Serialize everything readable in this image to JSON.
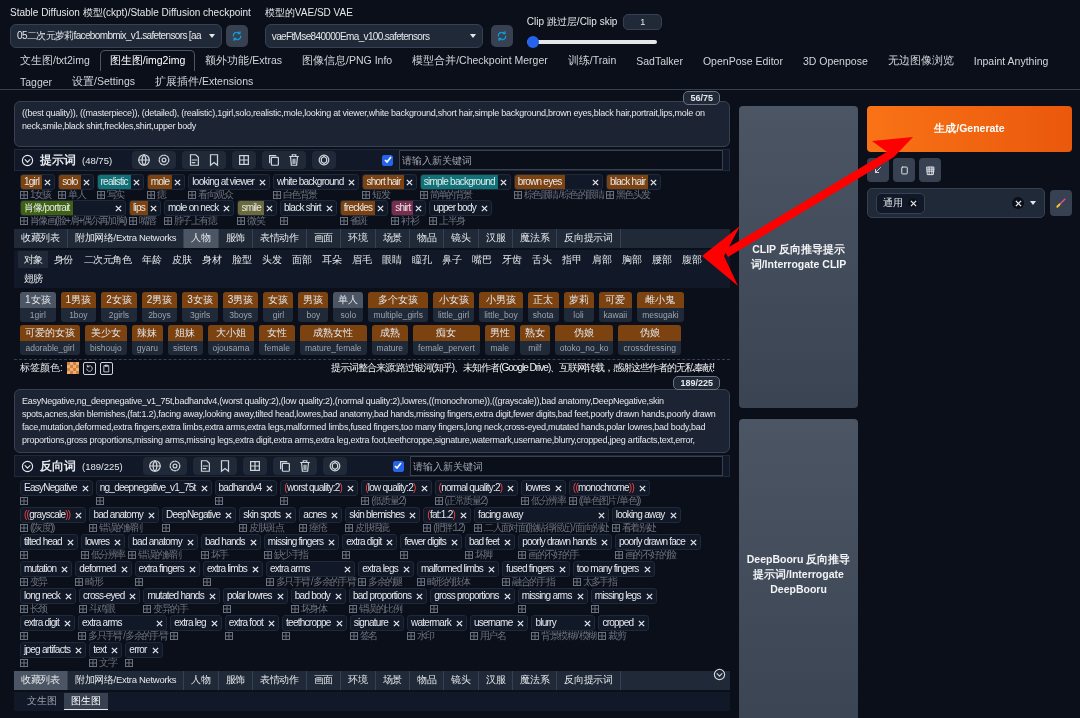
{
  "top": {
    "checkpoint": {
      "label": "Stable Diffusion 模型(ckpt)/Stable Diffusion checkpoint",
      "value": "05二次元萝莉facebombmix_v1.safetensors [aa"
    },
    "vae": {
      "label": "模型的VAE/SD VAE",
      "value": "vaeFtMse840000Ema_v100.safetensors"
    },
    "clip_skip": {
      "label": "Clip 跳过层/Clip skip",
      "value": "1",
      "level": 0
    }
  },
  "tabs": [
    {
      "label": "文生图/txt2img",
      "selected": false
    },
    {
      "label": "图生图/img2img",
      "selected": true
    },
    {
      "label": "额外功能/Extras",
      "selected": false
    },
    {
      "label": "图像信息/PNG Info",
      "selected": false
    },
    {
      "label": "模型合并/Checkpoint Merger",
      "selected": false
    },
    {
      "label": "训练/Train",
      "selected": false
    },
    {
      "label": "SadTalker",
      "selected": false
    },
    {
      "label": "OpenPose Editor",
      "selected": false
    },
    {
      "label": "3D Openpose",
      "selected": false
    },
    {
      "label": "无边图像浏览",
      "selected": false
    },
    {
      "label": "Inpaint Anything",
      "selected": false
    },
    {
      "label": "Tagger",
      "selected": false
    },
    {
      "label": "设置/Settings",
      "selected": false
    },
    {
      "label": "扩展插件/Extensions",
      "selected": false
    }
  ],
  "prompt": {
    "counter": "56/75",
    "text": "((best quality)), ((masterpiece)), (detailed), (realistic),1girl,solo,realistic,mole,looking at viewer,white background,short hair,simple background,brown eyes,black hair,portrait,lips,mole on neck,smile,black shirt,freckles,shirt,upper body",
    "title": "提示词",
    "count": "(48/75)",
    "checked": true,
    "placeholder": "请输入新关键词",
    "tags": [
      {
        "text": "1girl",
        "color": "#7c4210",
        "translation": "1女孩"
      },
      {
        "text": "solo",
        "color": "#7c4210",
        "translation": "单人"
      },
      {
        "text": "realistic",
        "color": "#0f7276",
        "translation": "写实"
      },
      {
        "text": "mole",
        "color": "#7c4210",
        "translation": "痣"
      },
      {
        "text": "looking at viewer",
        "translation": "看向观众"
      },
      {
        "text": "white background",
        "translation": "白色背景"
      },
      {
        "text": "short hair",
        "color": "#7c4210",
        "translation": "短发"
      },
      {
        "text": "simple background",
        "color": "#0f7276",
        "translation": "简单的背景"
      },
      {
        "text": "brown eyes",
        "color": "#7c4210",
        "translation": "棕色眼睛 / 棕色的眼睛"
      },
      {
        "text": "black hair",
        "color": "#7c4210",
        "translation": "黑色头发"
      },
      {
        "text": "肖像/portrait",
        "color": "#3f6212",
        "translation": "肖像画(脸+肩+偶尔再加胸)"
      },
      {
        "text": "lips",
        "color": "#7c4210",
        "translation": "嘴唇"
      },
      {
        "text": "mole on neck",
        "translation": "脖子上有痣"
      },
      {
        "text": "smile",
        "color": "#6b6a3c",
        "translation": "微笑"
      },
      {
        "text": "black shirt"
      },
      {
        "text": "freckles",
        "color": "#7c4210",
        "translation": "雀斑"
      },
      {
        "text": "shirt",
        "color": "#7a2d4c",
        "translation": "衬衫"
      },
      {
        "text": "upper body",
        "translation": "上半身"
      }
    ]
  },
  "categories": [
    {
      "label": "收藏列表",
      "selected": false
    },
    {
      "label": "附加网络/Extra Networks",
      "selected": false
    },
    {
      "label": "人物",
      "selected": true
    },
    {
      "label": "服饰",
      "selected": false
    },
    {
      "label": "表情动作",
      "selected": false
    },
    {
      "label": "画面",
      "selected": false
    },
    {
      "label": "环境",
      "selected": false
    },
    {
      "label": "场景",
      "selected": false
    },
    {
      "label": "物品",
      "selected": false
    },
    {
      "label": "镜头",
      "selected": false
    },
    {
      "label": "汉服",
      "selected": false
    },
    {
      "label": "魔法系",
      "selected": false
    },
    {
      "label": "反向提示词",
      "selected": false
    }
  ],
  "subcategories": [
    {
      "label": "对象",
      "selected": true
    },
    {
      "label": "身份",
      "selected": false
    },
    {
      "label": "二次元角色",
      "selected": false
    },
    {
      "label": "年龄",
      "selected": false
    },
    {
      "label": "皮肤",
      "selected": false
    },
    {
      "label": "身材",
      "selected": false
    },
    {
      "label": "脸型",
      "selected": false
    },
    {
      "label": "头发",
      "selected": false
    },
    {
      "label": "面部",
      "selected": false
    },
    {
      "label": "耳朵",
      "selected": false
    },
    {
      "label": "眉毛",
      "selected": false
    },
    {
      "label": "眼睛",
      "selected": false
    },
    {
      "label": "瞳孔",
      "selected": false
    },
    {
      "label": "鼻子",
      "selected": false
    },
    {
      "label": "嘴巴",
      "selected": false
    },
    {
      "label": "牙齿",
      "selected": false
    },
    {
      "label": "舌头",
      "selected": false
    },
    {
      "label": "指甲",
      "selected": false
    },
    {
      "label": "肩部",
      "selected": false
    },
    {
      "label": "胸部",
      "selected": false
    },
    {
      "label": "腰部",
      "selected": false
    },
    {
      "label": "腹部",
      "selected": false
    },
    {
      "label": "翅膀",
      "selected": false
    }
  ],
  "keywords": [
    {
      "zh": "1女孩",
      "en": "1girl",
      "added": true
    },
    {
      "zh": "1男孩",
      "en": "1boy",
      "added": false
    },
    {
      "zh": "2女孩",
      "en": "2girls",
      "added": false
    },
    {
      "zh": "2男孩",
      "en": "2boys",
      "added": false
    },
    {
      "zh": "3女孩",
      "en": "3girls",
      "added": false
    },
    {
      "zh": "3男孩",
      "en": "3boys",
      "added": false
    },
    {
      "zh": "女孩",
      "en": "girl",
      "added": false
    },
    {
      "zh": "男孩",
      "en": "boy",
      "added": false
    },
    {
      "zh": "单人",
      "en": "solo",
      "added": true
    },
    {
      "zh": "多个女孩",
      "en": "multiple_girls",
      "added": false
    },
    {
      "zh": "小女孩",
      "en": "little_girl",
      "added": false
    },
    {
      "zh": "小男孩",
      "en": "little_boy",
      "added": false
    },
    {
      "zh": "正太",
      "en": "shota",
      "added": false
    },
    {
      "zh": "萝莉",
      "en": "loli",
      "added": false
    },
    {
      "zh": "可爱",
      "en": "kawaii",
      "added": false
    },
    {
      "zh": "雌小鬼",
      "en": "mesugaki",
      "added": false
    },
    {
      "zh": "可爱的女孩",
      "en": "adorable_girl",
      "added": false
    },
    {
      "zh": "美少女",
      "en": "bishoujo",
      "added": false
    },
    {
      "zh": "辣妹",
      "en": "gyaru",
      "added": false
    },
    {
      "zh": "姐妹",
      "en": "sisters",
      "added": false
    },
    {
      "zh": "大小姐",
      "en": "ojousama",
      "added": false
    },
    {
      "zh": "女性",
      "en": "female",
      "added": false
    },
    {
      "zh": "成熟女性",
      "en": "mature_female",
      "added": false
    },
    {
      "zh": "成熟",
      "en": "mature",
      "added": false
    },
    {
      "zh": "痴女",
      "en": "female_pervert",
      "added": false
    },
    {
      "zh": "男性",
      "en": "male",
      "added": false
    },
    {
      "zh": "熟女",
      "en": "milf",
      "added": false
    },
    {
      "zh": "伪娘",
      "en": "otoko_no_ko",
      "added": false
    },
    {
      "zh": "伪娘",
      "en": "crossdressing",
      "added": false
    }
  ],
  "tag_color_label": "标签颜色:",
  "credits": "提示词整合来源:路过银河(知乎)、未知作者(Google Drive)、互联网转载，感谢这些作者的无私奉献!",
  "negative": {
    "counter": "189/225",
    "text": "EasyNegative,ng_deepnegative_v1_75t,badhandv4,(worst quality:2),(low quality:2),(normal quality:2),lowres,((monochrome)),((grayscale)),bad anatomy,DeepNegative,skin spots,acnes,skin blemishes,(fat:1.2),facing away,looking away,tilted head,lowres,bad anatomy,bad hands,missing fingers,extra digit,fewer digits,bad feet,poorly drawn hands,poorly drawn face,mutation,deformed,extra fingers,extra limbs,extra arms,extra legs,malformed limbs,fused fingers,too many fingers,long neck,cross-eyed,mutated hands,polar lowres,bad body,bad proportions,gross proportions,missing arms,missing legs,extra digit,extra arms,extra leg,extra foot,teethcroppe,signature,watermark,username,blurry,cropped,jpeg artifacts,text,error,",
    "title": "反向词",
    "count": "(189/225)",
    "checked": true,
    "placeholder": "请输入新关键词",
    "tags": [
      {
        "text": "EasyNegative"
      },
      {
        "text": "ng_deepnegative_v1_75t"
      },
      {
        "text": "badhandv4"
      },
      {
        "text": "worst quality:2",
        "open": "(",
        "close": ")"
      },
      {
        "text": "low quality:2",
        "open": "(",
        "close": ")",
        "translation": "(低质量:2)"
      },
      {
        "text": "normal quality:2",
        "open": "(",
        "close": ")",
        "translation": "(正常质量:2)"
      },
      {
        "text": "lowres",
        "translation": "低分辨率"
      },
      {
        "text": "monochrome",
        "open": "((",
        "close": "))",
        "translation": "((单色图片 / 单色))"
      },
      {
        "text": "grayscale",
        "open": "((",
        "close": "))",
        "translation": "((灰度))"
      },
      {
        "text": "bad anatomy",
        "translation": "错误的解剖"
      },
      {
        "text": "DeepNegative"
      },
      {
        "text": "skin spots",
        "translation": "皮肤斑点"
      },
      {
        "text": "acnes",
        "translation": "痤疮"
      },
      {
        "text": "skin blemishes",
        "translation": "皮肤瑕疵"
      },
      {
        "text": "fat:1.2",
        "open": "(",
        "close": ")",
        "translation": "(肥胖:1.2)"
      },
      {
        "text": "facing away",
        "translation": "二人面对面(脸贴得很近) / 面向别处"
      },
      {
        "text": "looking away",
        "translation": "看着别处"
      },
      {
        "text": "tilted head"
      },
      {
        "text": "lowres",
        "translation": "低分辨率"
      },
      {
        "text": "bad anatomy",
        "translation": "错误的解剖"
      },
      {
        "text": "bad hands",
        "translation": "坏手"
      },
      {
        "text": "missing fingers",
        "translation": "缺少手指"
      },
      {
        "text": "extra digit"
      },
      {
        "text": "fewer digits"
      },
      {
        "text": "bad feet",
        "translation": "坏脚"
      },
      {
        "text": "poorly drawn hands",
        "translation": "画的不好的手"
      },
      {
        "text": "poorly drawn face",
        "translation": "画的不好的脸"
      },
      {
        "text": "mutation",
        "translation": "变异"
      },
      {
        "text": "deformed",
        "translation": "畸形"
      },
      {
        "text": "extra fingers"
      },
      {
        "text": "extra limbs"
      },
      {
        "text": "extra arms",
        "translation": "多只手臂 / 多余的手臂"
      },
      {
        "text": "extra legs",
        "translation": "多余的腿"
      },
      {
        "text": "malformed limbs",
        "translation": "畸形的肢体"
      },
      {
        "text": "fused fingers",
        "translation": "融合的手指"
      },
      {
        "text": "too many fingers",
        "translation": "太多手指"
      },
      {
        "text": "long neck",
        "translation": "长颈"
      },
      {
        "text": "cross-eyed",
        "translation": "斗鸡眼"
      },
      {
        "text": "mutated hands",
        "translation": "变异的手"
      },
      {
        "text": "polar lowres"
      },
      {
        "text": "bad body",
        "translation": "坏身体"
      },
      {
        "text": "bad proportions",
        "translation": "错误的比例"
      },
      {
        "text": "gross proportions"
      },
      {
        "text": "missing arms"
      },
      {
        "text": "missing legs"
      },
      {
        "text": "extra digit"
      },
      {
        "text": "extra arms",
        "translation": "多只手臂 / 多余的手臂"
      },
      {
        "text": "extra leg"
      },
      {
        "text": "extra foot"
      },
      {
        "text": "teethcroppe"
      },
      {
        "text": "signature",
        "translation": "签名"
      },
      {
        "text": "watermark",
        "translation": "水印"
      },
      {
        "text": "username",
        "translation": "用户名"
      },
      {
        "text": "blurry",
        "translation": "背景模糊 / 模糊"
      },
      {
        "text": "cropped",
        "translation": "裁剪"
      },
      {
        "text": "jpeg artifacts"
      },
      {
        "text": "text",
        "translation": "文字"
      },
      {
        "text": "error"
      }
    ]
  },
  "bottom_categories": [
    {
      "label": "收藏列表",
      "selected": true
    },
    {
      "label": "附加网络/Extra Networks",
      "selected": false
    },
    {
      "label": "人物",
      "selected": false
    },
    {
      "label": "服饰",
      "selected": false
    },
    {
      "label": "表情动作",
      "selected": false
    },
    {
      "label": "画面",
      "selected": false
    },
    {
      "label": "环境",
      "selected": false
    },
    {
      "label": "场景",
      "selected": false
    },
    {
      "label": "物品",
      "selected": false
    },
    {
      "label": "镜头",
      "selected": false
    },
    {
      "label": "汉服",
      "selected": false
    },
    {
      "label": "魔法系",
      "selected": false
    },
    {
      "label": "反向提示词",
      "selected": false
    }
  ],
  "bottom_subtabs": [
    {
      "label": "文生图",
      "selected": false
    },
    {
      "label": "图生图",
      "selected": true
    }
  ],
  "interrogate_clip": "CLIP 反向推导提示词/Interrogate CLIP",
  "interrogate_deepbooru": "DeepBooru 反向推导提示词/Interrogate DeepBooru",
  "generate": "生成/Generate",
  "styles": [
    {
      "label": "通用"
    }
  ]
}
